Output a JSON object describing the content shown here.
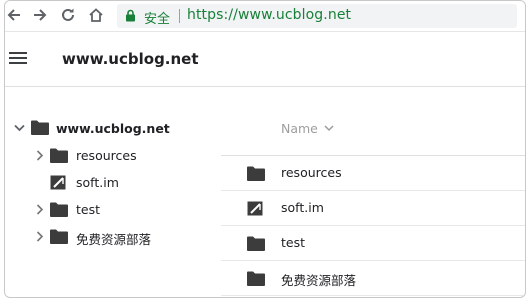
{
  "browser": {
    "secure_label": "安全",
    "url": "https://www.ucblog.net"
  },
  "header": {
    "title": "www.ucblog.net"
  },
  "tree": {
    "root": "www.ucblog.net",
    "items": [
      {
        "label": "resources",
        "type": "folder"
      },
      {
        "label": "soft.im",
        "type": "shortcut"
      },
      {
        "label": "test",
        "type": "folder"
      },
      {
        "label": "免费资源部落",
        "type": "folder"
      }
    ]
  },
  "list": {
    "name_header": "Name",
    "rows": [
      {
        "label": "resources",
        "type": "folder"
      },
      {
        "label": "soft.im",
        "type": "shortcut"
      },
      {
        "label": "test",
        "type": "folder"
      },
      {
        "label": "免费资源部落",
        "type": "folder"
      }
    ]
  },
  "colors": {
    "secure_green": "#188038",
    "icon_dark": "#3c3c3c",
    "muted_text": "#9e9e9e"
  }
}
